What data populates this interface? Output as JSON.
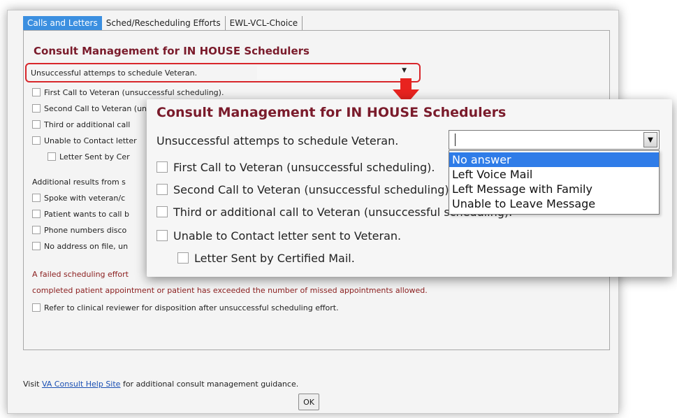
{
  "tabs": [
    {
      "label": "Calls and Letters",
      "active": true
    },
    {
      "label": "Sched/Rescheduling Efforts",
      "active": false
    },
    {
      "label": "EWL-VCL-Choice",
      "active": false
    }
  ],
  "background": {
    "heading": "Consult Management for IN HOUSE Schedulers",
    "select_label": "Unsuccessful attemps to schedule Veteran.",
    "checkboxes": [
      "First Call to Veteran (unsuccessful scheduling).",
      "Second Call to Veteran (unsuccessful scheduling).",
      "Third or additional call",
      "Unable to Contact letter"
    ],
    "indented_checkbox": "Letter Sent by Cer",
    "additional_label": "Additional results from s",
    "additional_checkboxes": [
      "Spoke with veteran/c",
      "Patient wants to call b",
      "Phone numbers disco",
      "No address on file, un"
    ],
    "failed_text_1": "A failed scheduling effort",
    "failed_text_2": "completed patient appointment or patient has exceeded the number of missed appointments allowed.",
    "refer_checkbox": "Refer to clinical reviewer for disposition after unsuccessful scheduling effort.",
    "footer_prefix": "Visit",
    "footer_link": "VA Consult Help Site",
    "footer_suffix": "for additional consult management guidance.",
    "ok_label": "OK"
  },
  "zoom": {
    "heading": "Consult Management for IN HOUSE Schedulers",
    "select_label": "Unsuccessful attemps to schedule Veteran.",
    "checkboxes": [
      "First Call to Veteran (unsuccessful scheduling).",
      "Second Call to Veteran (unsuccessful scheduling).",
      "Third or additional call to Veteran (unsuccessful scheduling).",
      "Unable to Contact letter sent to Veteran."
    ],
    "indented_checkbox": "Letter Sent by Certified Mail.",
    "select_value": "",
    "dropdown_options": [
      "No answer",
      "Left Voice Mail",
      "Left Message with Family",
      "Unable to Leave Message"
    ],
    "selected_option": "No answer"
  },
  "colors": {
    "heading_red": "#7a1b2b",
    "highlight_border": "#d8262b",
    "arrow_red": "#e8231f",
    "tab_active": "#3b8fe0",
    "option_selected": "#2f7ce8",
    "link_blue": "#1a4fb3"
  },
  "icons": {
    "dropdown": "chevron-down-icon",
    "arrow": "red-down-arrow-icon"
  }
}
